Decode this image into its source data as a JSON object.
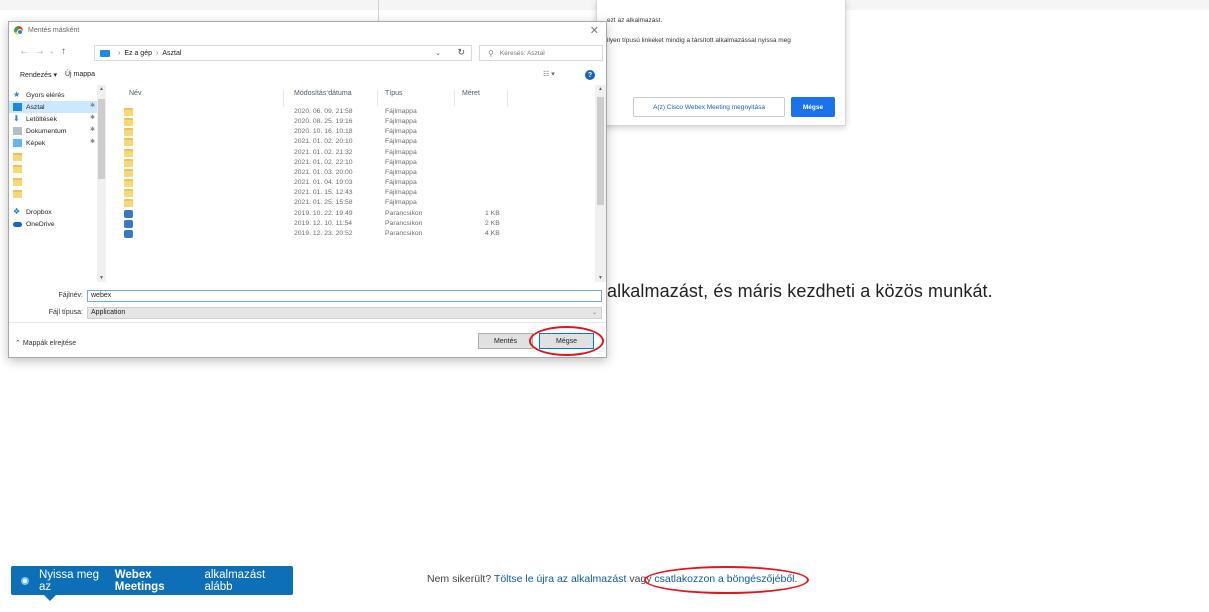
{
  "page": {
    "main_text": "alkalmazást, és máris kezdheti a közös munkát.",
    "toast": {
      "prefix": "Nyissa meg az ",
      "brand": "Webex Meetings",
      "suffix": " alkalmazást alább"
    },
    "footer": {
      "question": "Nem sikerült? ",
      "link1": "Töltse le újra az alkalmazást",
      "middle": " vagy ",
      "link2": "csatlakozzon a böngészőjéből",
      "end": "."
    }
  },
  "prompt": {
    "line1": "ezt az alkalmazást.",
    "line2": "ilyen típusú linkeket mindig a társított alkalmazással nyissa meg",
    "open_button": "A(z) Cisco Webex Meeting megnyitása",
    "cancel_button": "Mégse"
  },
  "dialog": {
    "title": "Mentés másként",
    "address": {
      "part1": "Ez a gép",
      "part2": "Asztal"
    },
    "search_placeholder": "Keresés: Asztal",
    "toolbar": {
      "organize": "Rendezés ▾",
      "new_folder": "Új mappa"
    },
    "tree": [
      {
        "label": "Gyors elérés",
        "icon": "star-icon",
        "pinned": false
      },
      {
        "label": "Asztal",
        "icon": "desktop-icon",
        "pinned": true
      },
      {
        "label": "Letöltések",
        "icon": "download-icon",
        "pinned": true
      },
      {
        "label": "Dokumentum",
        "icon": "document-icon",
        "pinned": true
      },
      {
        "label": "Képek",
        "icon": "pictures-icon",
        "pinned": true
      },
      {
        "label": "",
        "icon": "folder-icon",
        "pinned": false
      },
      {
        "label": "",
        "icon": "folder-icon",
        "pinned": false
      },
      {
        "label": "",
        "icon": "folder-icon",
        "pinned": false
      },
      {
        "label": "",
        "icon": "folder-icon",
        "pinned": false
      },
      {
        "label": "Dropbox",
        "icon": "dropbox-icon",
        "pinned": false
      },
      {
        "label": "OneDrive",
        "icon": "onedrive-icon",
        "pinned": false
      }
    ],
    "columns": {
      "name": "Név",
      "modified": "Módosítás dátuma",
      "type": "Típus",
      "size": "Méret"
    },
    "rows": [
      {
        "modified": "2020. 06. 09. 21:58",
        "type": "Fájlmappa",
        "size": "",
        "icon": "folder-icon"
      },
      {
        "modified": "2020. 08. 25. 19:16",
        "type": "Fájlmappa",
        "size": "",
        "icon": "folder-icon"
      },
      {
        "modified": "2020. 10. 16. 10:18",
        "type": "Fájlmappa",
        "size": "",
        "icon": "folder-icon"
      },
      {
        "modified": "2021. 01. 02. 20:10",
        "type": "Fájlmappa",
        "size": "",
        "icon": "folder-icon"
      },
      {
        "modified": "2021. 01. 02. 21:32",
        "type": "Fájlmappa",
        "size": "",
        "icon": "folder-icon"
      },
      {
        "modified": "2021. 01. 02. 22:10",
        "type": "Fájlmappa",
        "size": "",
        "icon": "folder-icon"
      },
      {
        "modified": "2021. 01. 03. 20:00",
        "type": "Fájlmappa",
        "size": "",
        "icon": "folder-icon"
      },
      {
        "modified": "2021. 01. 04. 19:03",
        "type": "Fájlmappa",
        "size": "",
        "icon": "folder-icon"
      },
      {
        "modified": "2021. 01. 15. 12:43",
        "type": "Fájlmappa",
        "size": "",
        "icon": "folder-icon"
      },
      {
        "modified": "2021. 01. 25. 15:58",
        "type": "Fájlmappa",
        "size": "",
        "icon": "folder-icon"
      },
      {
        "modified": "2019. 10. 22. 19:49",
        "type": "Parancsikon",
        "size": "1 KB",
        "icon": "shortcut-icon"
      },
      {
        "modified": "2019. 12. 10. 11:54",
        "type": "Parancsikon",
        "size": "2 KB",
        "icon": "shortcut-icon"
      },
      {
        "modified": "2019. 12. 23. 20:52",
        "type": "Parancsikon",
        "size": "4 KB",
        "icon": "shortcut-icon"
      }
    ],
    "filename_label": "Fájlnév:",
    "filename_value": "webex",
    "filetype_label": "Fájl típusa:",
    "filetype_value": "Application",
    "hide_folders": "Mappák elrejtése",
    "save_button": "Mentés",
    "cancel_button": "Mégse"
  },
  "colors": {
    "accent": "#1a73e8",
    "toast": "#0d6fb8",
    "highlight_ellipse": "#e0161d",
    "selected_row": "#cce8ff"
  }
}
